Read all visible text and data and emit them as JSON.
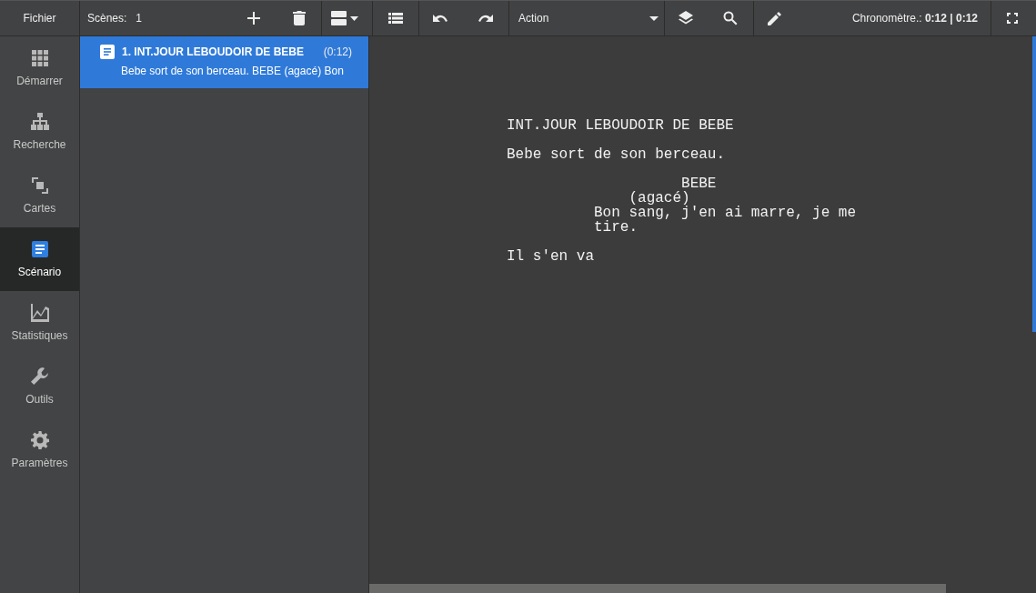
{
  "toolbar": {
    "file_menu": "Fichier",
    "scenes_label": "Scènes:",
    "scenes_count": "1",
    "style_dropdown": "Action",
    "timer": "Chronomètre.: **0:12 | 0:12**"
  },
  "sidebar": {
    "items": [
      {
        "label": "Démarrer",
        "kind": "grid",
        "selected": false
      },
      {
        "label": "Recherche",
        "kind": "tree",
        "selected": false
      },
      {
        "label": "Cartes",
        "kind": "cards",
        "selected": false
      },
      {
        "label": "Scénario",
        "kind": "doc",
        "selected": true
      },
      {
        "label": "Statistiques",
        "kind": "chart",
        "selected": false
      },
      {
        "label": "Outils",
        "kind": "wrench",
        "selected": false
      },
      {
        "label": "Paramètres",
        "kind": "gear",
        "selected": false
      }
    ]
  },
  "scenes": [
    {
      "title": "1. INT.JOUR LEBOUDOIR DE BEBE",
      "duration": "(0:12)",
      "summary": "Bebe sort de son berceau. BEBE (agacé) Bon",
      "selected": true
    }
  ],
  "script": [
    {
      "kind": "heading",
      "text": "INT.JOUR LEBOUDOIR DE BEBE"
    },
    {
      "kind": "action",
      "text": "Bebe sort de son berceau."
    },
    {
      "kind": "character",
      "text": "BEBE"
    },
    {
      "kind": "parenthetical",
      "text": "(agacé)"
    },
    {
      "kind": "dialogue",
      "text": "Bon sang, j'en ai marre, je me tire."
    },
    {
      "kind": "action",
      "text": "Il s'en va"
    }
  ]
}
